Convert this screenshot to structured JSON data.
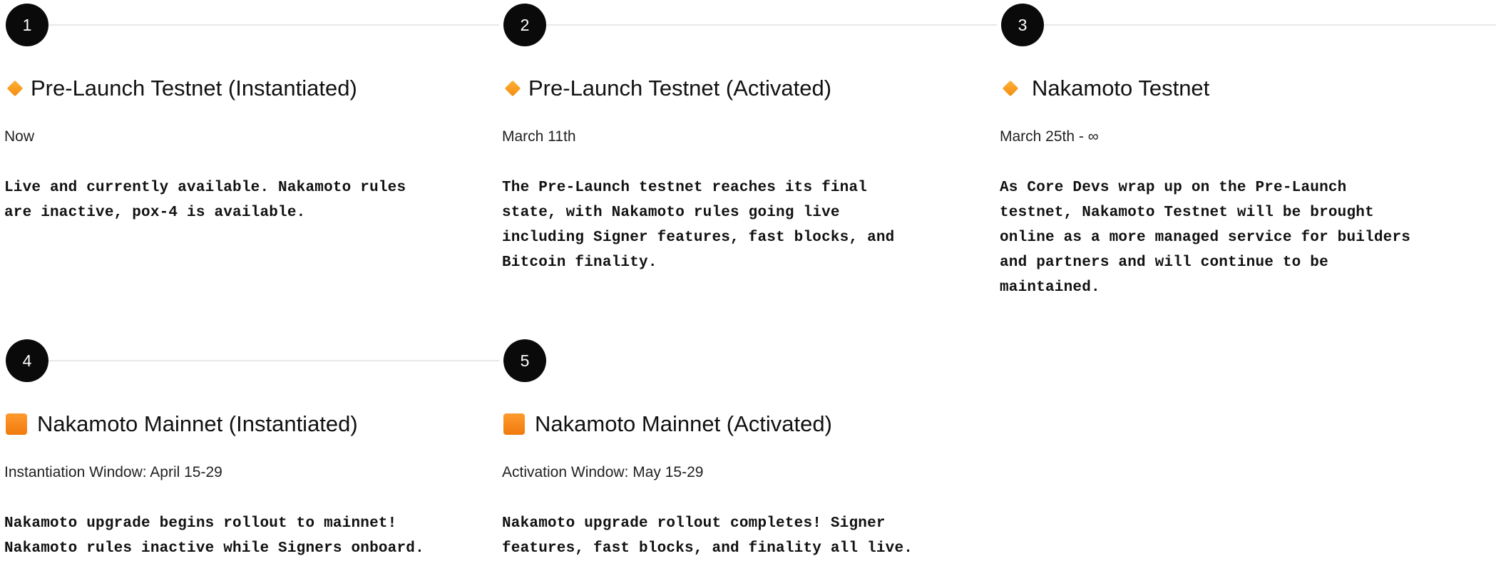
{
  "steps": [
    {
      "number": "1",
      "icon": "orange-diamond-icon",
      "title": "Pre-Launch Testnet (Instantiated)",
      "date": "Now",
      "description_lines": [
        "Live and currently available. Nakamoto rules",
        "are inactive, pox-4 is available."
      ]
    },
    {
      "number": "2",
      "icon": "orange-diamond-icon",
      "title": "Pre-Launch Testnet (Activated)",
      "date": "March 11th",
      "description_lines": [
        "The Pre-Launch testnet reaches its final",
        "state, with Nakamoto rules going live",
        "including Signer features, fast blocks, and",
        "Bitcoin finality."
      ]
    },
    {
      "number": "3",
      "icon": "orange-diamond-icon",
      "title": "Nakamoto Testnet",
      "date": "March 25th - ∞",
      "description_lines": [
        "As Core Devs wrap up on the Pre-Launch",
        "testnet, Nakamoto Testnet will be brought",
        "online as a more managed service for builders",
        "and partners and will continue to be",
        "maintained."
      ]
    },
    {
      "number": "4",
      "icon": "orange-square-icon",
      "title": "Nakamoto Mainnet (Instantiated)",
      "date": "Instantiation Window: April 15-29",
      "description_lines": [
        "Nakamoto upgrade begins rollout to mainnet!",
        "Nakamoto rules inactive while Signers onboard."
      ]
    },
    {
      "number": "5",
      "icon": "orange-square-icon",
      "title": "Nakamoto Mainnet (Activated)",
      "date": "Activation Window: May 15-29",
      "description_lines": [
        "Nakamoto upgrade rollout completes! Signer",
        "features, fast blocks, and finality all live."
      ]
    }
  ]
}
